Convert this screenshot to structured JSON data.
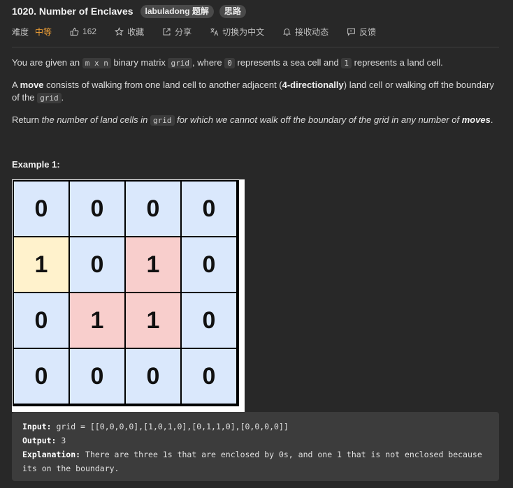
{
  "header": {
    "title": "1020. Number of Enclaves",
    "tags": [
      "labuladong 题解",
      "思路"
    ]
  },
  "meta": {
    "difficulty_label": "难度",
    "difficulty_value": "中等",
    "likes": "162",
    "favorite": "收藏",
    "share": "分享",
    "switch_lang": "切换为中文",
    "notify": "接收动态",
    "feedback": "反馈"
  },
  "description": {
    "p1_a": "You are given an ",
    "p1_code1": "m x n",
    "p1_b": " binary matrix ",
    "p1_code2": "grid",
    "p1_c": ", where ",
    "p1_code3": "0",
    "p1_d": " represents a sea cell and ",
    "p1_code4": "1",
    "p1_e": " represents a land cell.",
    "p2_a": "A ",
    "p2_bold1": "move",
    "p2_b": " consists of walking from one land cell to another adjacent (",
    "p2_bold2": "4-directionally",
    "p2_c": ") land cell or walking off the boundary of the ",
    "p2_code1": "grid",
    "p2_d": ".",
    "p3_a": "Return ",
    "p3_i1": "the number of land cells in ",
    "p3_code1": "grid",
    "p3_i2": " for which we cannot walk off the boundary of the grid in any number of ",
    "p3_bold1": "moves",
    "p3_e": "."
  },
  "example": {
    "title": "Example 1:",
    "grid": [
      [
        "0",
        "0",
        "0",
        "0"
      ],
      [
        "1",
        "0",
        "1",
        "0"
      ],
      [
        "0",
        "1",
        "1",
        "0"
      ],
      [
        "0",
        "0",
        "0",
        "0"
      ]
    ],
    "cell_colors": [
      [
        "sea",
        "sea",
        "sea",
        "sea"
      ],
      [
        "edge",
        "sea",
        "enc",
        "sea"
      ],
      [
        "sea",
        "enc",
        "enc",
        "sea"
      ],
      [
        "sea",
        "sea",
        "sea",
        "sea"
      ]
    ],
    "input_label": "Input:",
    "input_value": " grid = [[0,0,0,0],[1,0,1,0],[0,1,1,0],[0,0,0,0]]",
    "output_label": "Output:",
    "output_value": " 3",
    "explanation_label": "Explanation:",
    "explanation_value": " There are three 1s that are enclosed by 0s, and one 1 that is not enclosed because its on the boundary."
  },
  "colors": {
    "background": "#282828",
    "difficulty": "#f2a136",
    "sea": "#dae8fc",
    "edge_land": "#fff2cc",
    "enclosed_land": "#f8cecc"
  }
}
